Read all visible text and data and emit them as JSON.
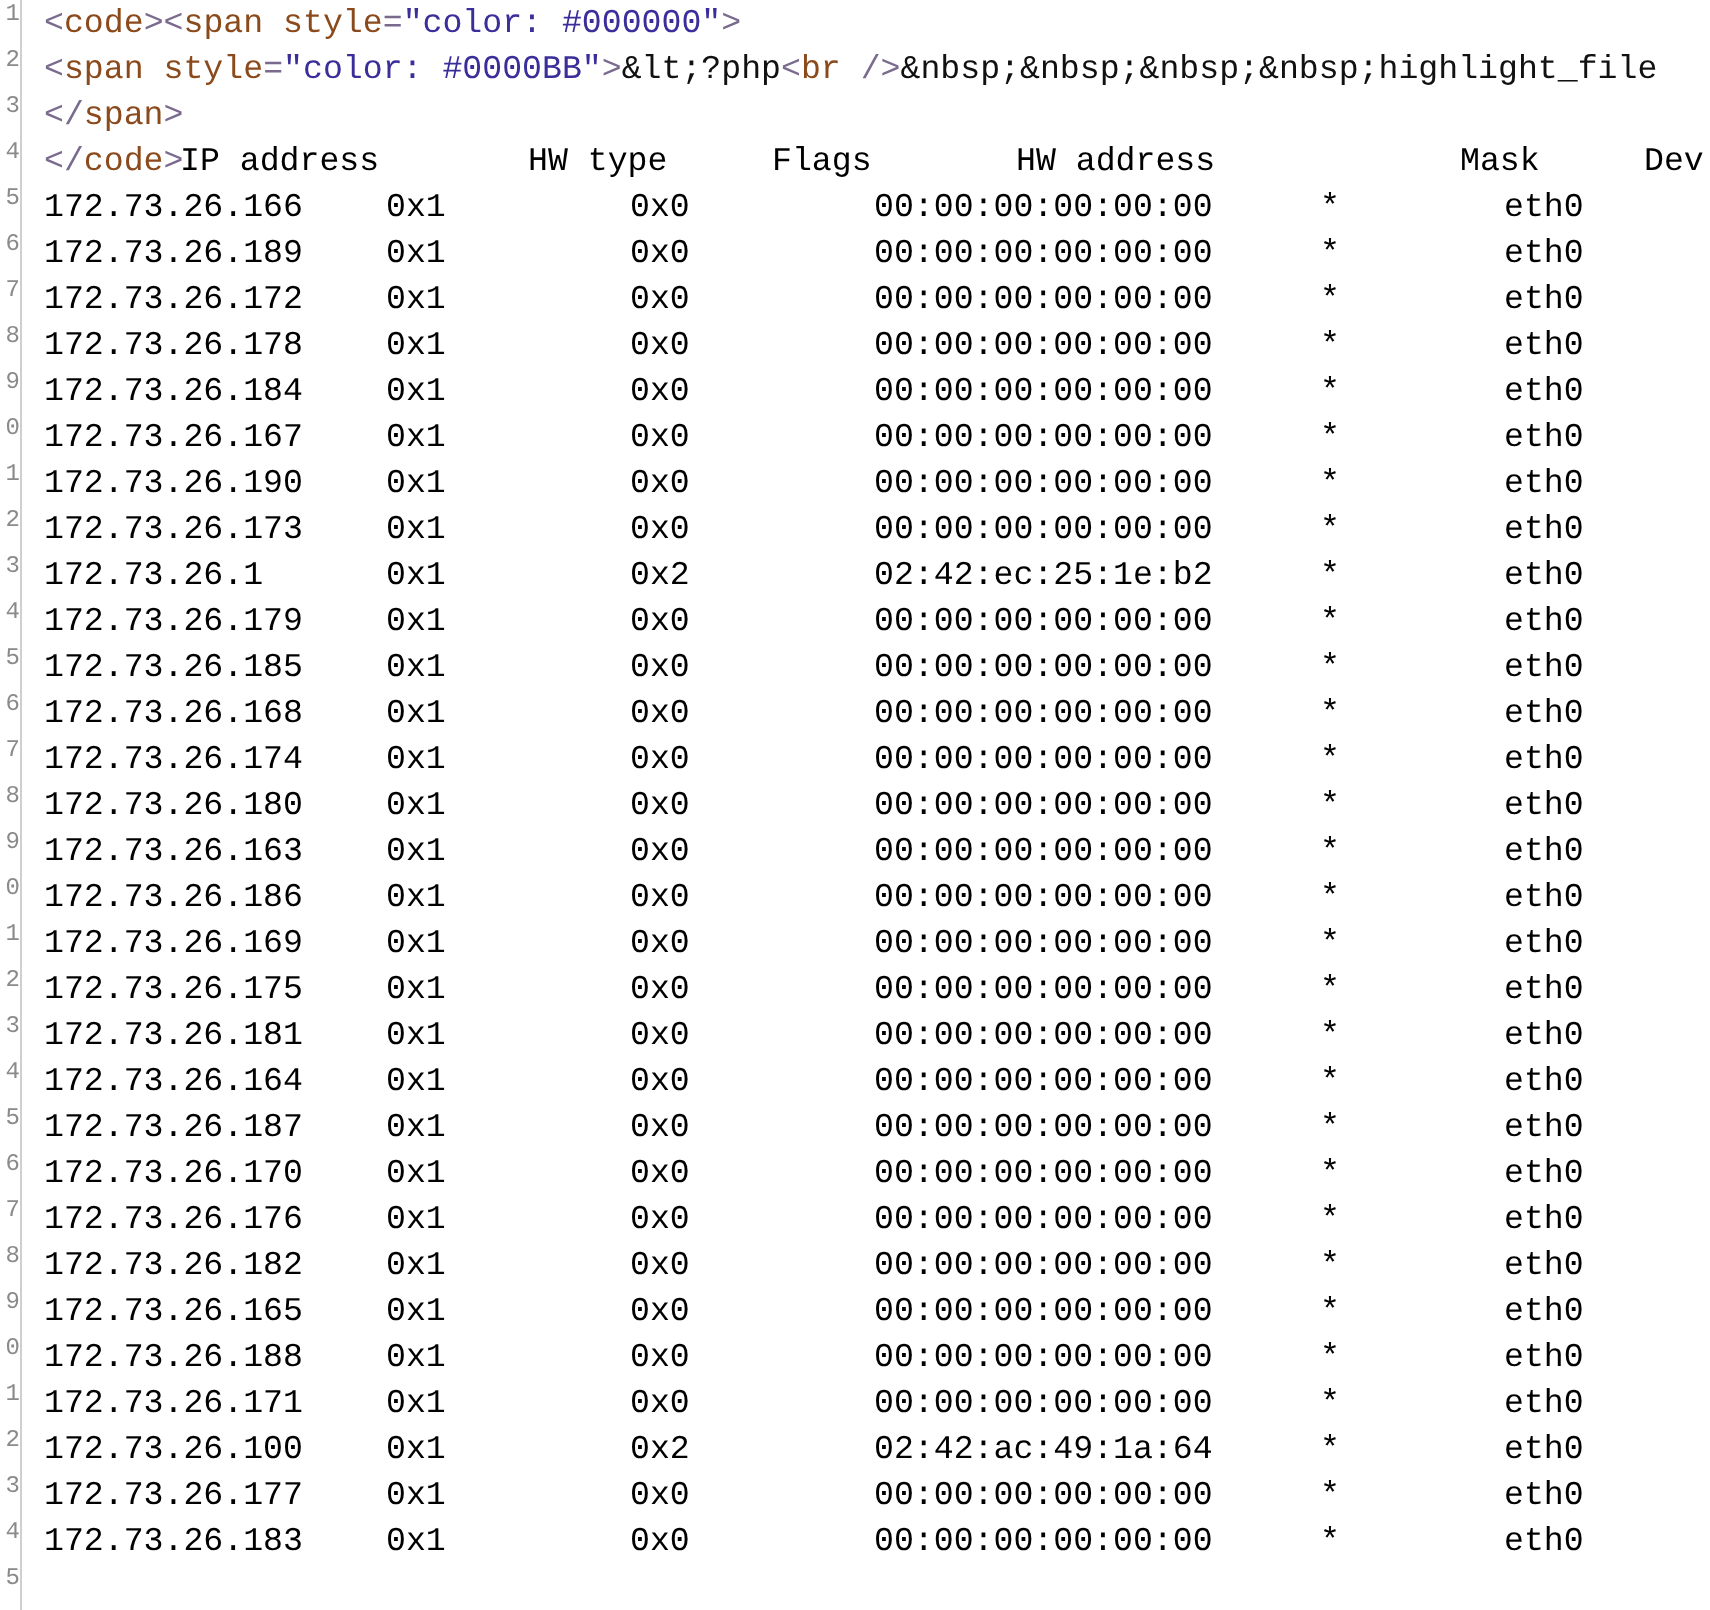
{
  "line_numbers": [
    "1",
    "2",
    "3",
    "4",
    "5",
    "6",
    "7",
    "8",
    "9",
    "0",
    "1",
    "2",
    "3",
    "4",
    "5",
    "6",
    "7",
    "8",
    "9",
    "0",
    "1",
    "2",
    "3",
    "4",
    "5",
    "6",
    "7",
    "8",
    "9",
    "0",
    "1",
    "2",
    "3",
    "4",
    "5"
  ],
  "markup_lines": [
    {
      "tokens": [
        {
          "kind": "punct",
          "text": "<"
        },
        {
          "kind": "tag",
          "text": "code"
        },
        {
          "kind": "punct",
          "text": ">"
        },
        {
          "kind": "punct",
          "text": "<"
        },
        {
          "kind": "tag",
          "text": "span "
        },
        {
          "kind": "attr",
          "text": "style"
        },
        {
          "kind": "punct",
          "text": "="
        },
        {
          "kind": "value",
          "text": "\"color: #000000\""
        },
        {
          "kind": "punct",
          "text": ">"
        }
      ]
    },
    {
      "tokens": [
        {
          "kind": "punct",
          "text": "<"
        },
        {
          "kind": "tag",
          "text": "span "
        },
        {
          "kind": "attr",
          "text": "style"
        },
        {
          "kind": "punct",
          "text": "="
        },
        {
          "kind": "value",
          "text": "\"color: #0000BB\""
        },
        {
          "kind": "punct",
          "text": ">"
        },
        {
          "kind": "text",
          "text": "&lt;?php"
        },
        {
          "kind": "punct",
          "text": "<"
        },
        {
          "kind": "tag",
          "text": "br "
        },
        {
          "kind": "punct",
          "text": "/>"
        },
        {
          "kind": "text",
          "text": "&nbsp;&nbsp;&nbsp;&nbsp;highlight_file"
        }
      ]
    },
    {
      "tokens": [
        {
          "kind": "punct",
          "text": "</"
        },
        {
          "kind": "tag",
          "text": "span"
        },
        {
          "kind": "punct",
          "text": ">"
        }
      ]
    }
  ],
  "header_prefix": [
    {
      "kind": "punct",
      "text": "</"
    },
    {
      "kind": "tag",
      "text": "code"
    },
    {
      "kind": "punct",
      "text": ">"
    }
  ],
  "arp_table": {
    "columns": [
      "IP address",
      "HW type",
      "Flags",
      "HW address",
      "Mask",
      "Dev"
    ],
    "rows": [
      [
        "172.73.26.166",
        "0x1",
        "0x0",
        "00:00:00:00:00:00",
        "*",
        "eth0"
      ],
      [
        "172.73.26.189",
        "0x1",
        "0x0",
        "00:00:00:00:00:00",
        "*",
        "eth0"
      ],
      [
        "172.73.26.172",
        "0x1",
        "0x0",
        "00:00:00:00:00:00",
        "*",
        "eth0"
      ],
      [
        "172.73.26.178",
        "0x1",
        "0x0",
        "00:00:00:00:00:00",
        "*",
        "eth0"
      ],
      [
        "172.73.26.184",
        "0x1",
        "0x0",
        "00:00:00:00:00:00",
        "*",
        "eth0"
      ],
      [
        "172.73.26.167",
        "0x1",
        "0x0",
        "00:00:00:00:00:00",
        "*",
        "eth0"
      ],
      [
        "172.73.26.190",
        "0x1",
        "0x0",
        "00:00:00:00:00:00",
        "*",
        "eth0"
      ],
      [
        "172.73.26.173",
        "0x1",
        "0x0",
        "00:00:00:00:00:00",
        "*",
        "eth0"
      ],
      [
        "172.73.26.1",
        "0x1",
        "0x2",
        "02:42:ec:25:1e:b2",
        "*",
        "eth0"
      ],
      [
        "172.73.26.179",
        "0x1",
        "0x0",
        "00:00:00:00:00:00",
        "*",
        "eth0"
      ],
      [
        "172.73.26.185",
        "0x1",
        "0x0",
        "00:00:00:00:00:00",
        "*",
        "eth0"
      ],
      [
        "172.73.26.168",
        "0x1",
        "0x0",
        "00:00:00:00:00:00",
        "*",
        "eth0"
      ],
      [
        "172.73.26.174",
        "0x1",
        "0x0",
        "00:00:00:00:00:00",
        "*",
        "eth0"
      ],
      [
        "172.73.26.180",
        "0x1",
        "0x0",
        "00:00:00:00:00:00",
        "*",
        "eth0"
      ],
      [
        "172.73.26.163",
        "0x1",
        "0x0",
        "00:00:00:00:00:00",
        "*",
        "eth0"
      ],
      [
        "172.73.26.186",
        "0x1",
        "0x0",
        "00:00:00:00:00:00",
        "*",
        "eth0"
      ],
      [
        "172.73.26.169",
        "0x1",
        "0x0",
        "00:00:00:00:00:00",
        "*",
        "eth0"
      ],
      [
        "172.73.26.175",
        "0x1",
        "0x0",
        "00:00:00:00:00:00",
        "*",
        "eth0"
      ],
      [
        "172.73.26.181",
        "0x1",
        "0x0",
        "00:00:00:00:00:00",
        "*",
        "eth0"
      ],
      [
        "172.73.26.164",
        "0x1",
        "0x0",
        "00:00:00:00:00:00",
        "*",
        "eth0"
      ],
      [
        "172.73.26.187",
        "0x1",
        "0x0",
        "00:00:00:00:00:00",
        "*",
        "eth0"
      ],
      [
        "172.73.26.170",
        "0x1",
        "0x0",
        "00:00:00:00:00:00",
        "*",
        "eth0"
      ],
      [
        "172.73.26.176",
        "0x1",
        "0x0",
        "00:00:00:00:00:00",
        "*",
        "eth0"
      ],
      [
        "172.73.26.182",
        "0x1",
        "0x0",
        "00:00:00:00:00:00",
        "*",
        "eth0"
      ],
      [
        "172.73.26.165",
        "0x1",
        "0x0",
        "00:00:00:00:00:00",
        "*",
        "eth0"
      ],
      [
        "172.73.26.188",
        "0x1",
        "0x0",
        "00:00:00:00:00:00",
        "*",
        "eth0"
      ],
      [
        "172.73.26.171",
        "0x1",
        "0x0",
        "00:00:00:00:00:00",
        "*",
        "eth0"
      ],
      [
        "172.73.26.100",
        "0x1",
        "0x2",
        "02:42:ac:49:1a:64",
        "*",
        "eth0"
      ],
      [
        "172.73.26.177",
        "0x1",
        "0x0",
        "00:00:00:00:00:00",
        "*",
        "eth0"
      ],
      [
        "172.73.26.183",
        "0x1",
        "0x0",
        "00:00:00:00:00:00",
        "*",
        "eth0"
      ]
    ]
  }
}
